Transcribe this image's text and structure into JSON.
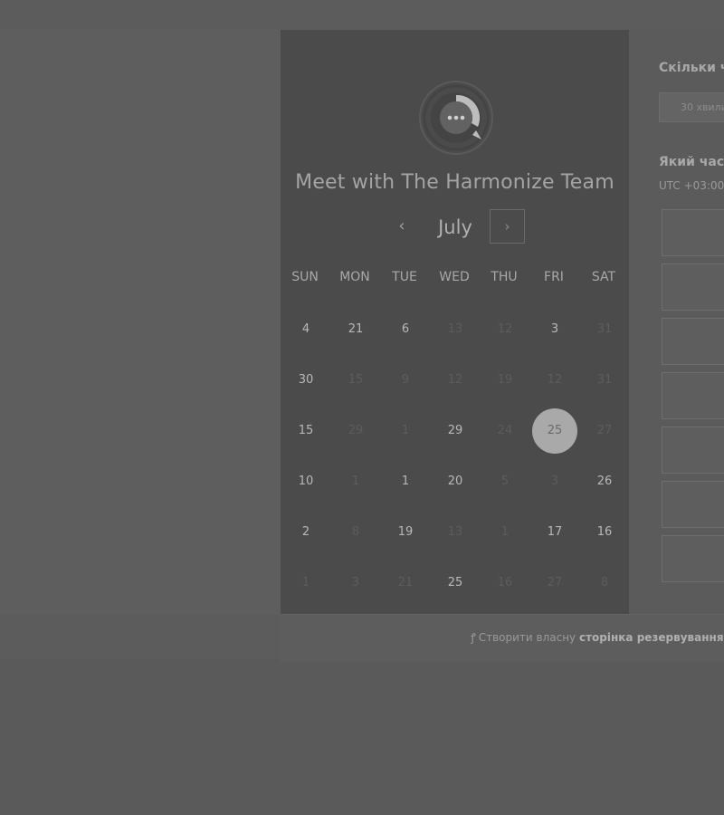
{
  "calendar": {
    "title": "Meet with The Harmonize Team",
    "month": "July",
    "prev_icon": "‹",
    "next_icon": "›",
    "weekdays": [
      "SUN",
      "MON",
      "TUE",
      "WED",
      "THU",
      "FRI",
      "SAT"
    ],
    "weeks": [
      [
        {
          "d": "4",
          "s": "available"
        },
        {
          "d": "21",
          "s": "available"
        },
        {
          "d": "6",
          "s": "available"
        },
        {
          "d": "13",
          "s": "unavailable"
        },
        {
          "d": "12",
          "s": "unavailable"
        },
        {
          "d": "3",
          "s": "available"
        },
        {
          "d": "31",
          "s": "unavailable"
        }
      ],
      [
        {
          "d": "30",
          "s": "available"
        },
        {
          "d": "15",
          "s": "unavailable"
        },
        {
          "d": "9",
          "s": "unavailable"
        },
        {
          "d": "12",
          "s": "unavailable"
        },
        {
          "d": "19",
          "s": "unavailable"
        },
        {
          "d": "12",
          "s": "unavailable"
        },
        {
          "d": "31",
          "s": "unavailable"
        }
      ],
      [
        {
          "d": "15",
          "s": "available"
        },
        {
          "d": "29",
          "s": "unavailable"
        },
        {
          "d": "1",
          "s": "unavailable"
        },
        {
          "d": "29",
          "s": "available"
        },
        {
          "d": "24",
          "s": "unavailable"
        },
        {
          "d": "25",
          "s": "selected"
        },
        {
          "d": "27",
          "s": "unavailable"
        }
      ],
      [
        {
          "d": "10",
          "s": "available"
        },
        {
          "d": "1",
          "s": "unavailable"
        },
        {
          "d": "1",
          "s": "available"
        },
        {
          "d": "20",
          "s": "available"
        },
        {
          "d": "5",
          "s": "unavailable"
        },
        {
          "d": "3",
          "s": "unavailable"
        },
        {
          "d": "26",
          "s": "available"
        }
      ],
      [
        {
          "d": "2",
          "s": "available"
        },
        {
          "d": "8",
          "s": "unavailable"
        },
        {
          "d": "19",
          "s": "available"
        },
        {
          "d": "13",
          "s": "unavailable"
        },
        {
          "d": "1",
          "s": "unavailable"
        },
        {
          "d": "17",
          "s": "available"
        },
        {
          "d": "16",
          "s": "available"
        }
      ],
      [
        {
          "d": "1",
          "s": "unavailable"
        },
        {
          "d": "3",
          "s": "unavailable"
        },
        {
          "d": "21",
          "s": "unavailable"
        },
        {
          "d": "25",
          "s": "available"
        },
        {
          "d": "16",
          "s": "unavailable"
        },
        {
          "d": "27",
          "s": "unavailable"
        },
        {
          "d": "8",
          "s": "unavailable"
        }
      ]
    ]
  },
  "form": {
    "duration_question": "Скільки ч",
    "duration_value": "30 хвили",
    "time_question": "Який час",
    "timezone": "UTC +03:00",
    "slot_count": 7
  },
  "footer": {
    "prefix": "Створити власну ",
    "bold": "сторінка резервування"
  },
  "colors": {
    "calendar_bg": "#4b4b4b",
    "selected_day_bg": "#a9a9a9",
    "page_bg": "#5a5a5a"
  }
}
